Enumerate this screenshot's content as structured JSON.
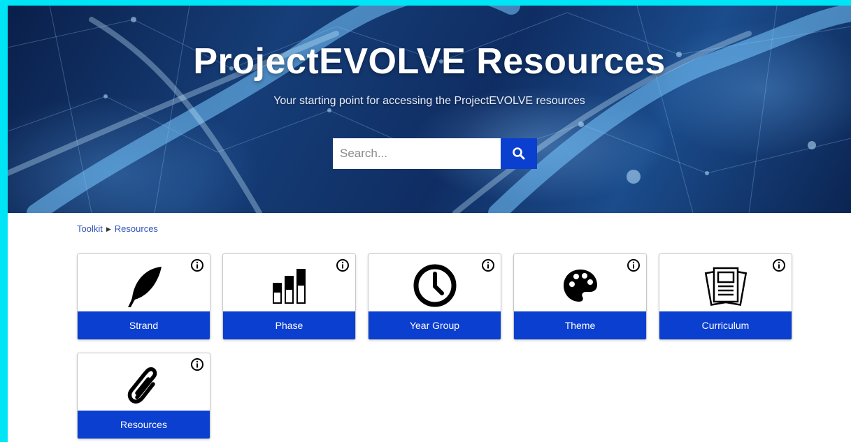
{
  "hero": {
    "title": "ProjectEVOLVE Resources",
    "subtitle": "Your starting point for accessing the ProjectEVOLVE resources"
  },
  "search": {
    "placeholder": "Search...",
    "value": "",
    "button_icon": "search-icon"
  },
  "breadcrumb": {
    "items": [
      "Toolkit",
      "Resources"
    ],
    "separator_icon": "triangle-right-icon"
  },
  "cards": [
    {
      "label": "Strand",
      "icon": "feather-icon"
    },
    {
      "label": "Phase",
      "icon": "bar-levels-icon"
    },
    {
      "label": "Year Group",
      "icon": "clock-icon"
    },
    {
      "label": "Theme",
      "icon": "palette-icon"
    },
    {
      "label": "Curriculum",
      "icon": "documents-icon"
    },
    {
      "label": "Resources",
      "icon": "paperclip-icon"
    }
  ],
  "colors": {
    "accent": "#0b3fcf",
    "frame": "#00e5f5",
    "breadcrumb_link": "#3355bb"
  }
}
